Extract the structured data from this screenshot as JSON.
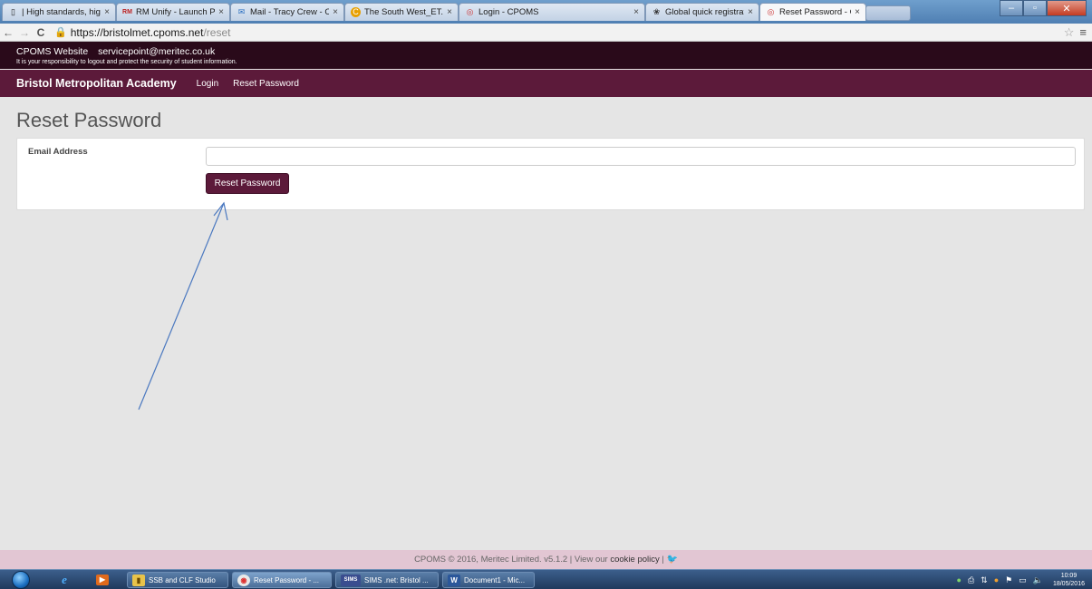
{
  "browser": {
    "tabs": [
      {
        "icon": "page-icon",
        "label": "| High standards, high exp"
      },
      {
        "icon": "rm-icon",
        "label": "RM Unify - Launch Pad"
      },
      {
        "icon": "mail-icon",
        "label": "Mail - Tracy Crew - Outlo"
      },
      {
        "icon": "pdf-icon",
        "label": "The South West_ET.pdf"
      },
      {
        "icon": "cpoms-icon",
        "label": "Login - CPOMS"
      },
      {
        "icon": "registration-icon",
        "label": "Global quick registration"
      },
      {
        "icon": "cpoms-icon",
        "label": "Reset Password - CPOMS"
      }
    ],
    "url_host": "https://bristolmet.cpoms.net",
    "url_path": "/reset"
  },
  "topbar": {
    "website_label": "CPOMS Website",
    "email": "servicepoint@meritec.co.uk",
    "notice": "It is your responsibility to logout and protect the security of student information."
  },
  "navbar": {
    "brand": "Bristol Metropolitan Academy",
    "links": [
      "Login",
      "Reset Password"
    ]
  },
  "page": {
    "title": "Reset Password",
    "email_label": "Email Address",
    "email_value": "",
    "submit_label": "Reset Password"
  },
  "footer": {
    "copyright": "CPOMS © 2016, Meritec Limited. v5.1.2 | View our ",
    "cookie_link": "cookie policy",
    "separator": " | "
  },
  "taskbar": {
    "tasks": [
      {
        "label": "SSB and CLF Studio"
      },
      {
        "label": "Reset Password - ..."
      },
      {
        "label": "SIMS .net: Bristol ..."
      },
      {
        "label": "Document1 - Mic..."
      }
    ],
    "time": "10:09",
    "date": "18/05/2016"
  },
  "colors": {
    "topbar": "#2a0a1a",
    "navbar": "#5c1a3a",
    "footer": "#e2c6d3",
    "button": "#5c1a3a",
    "annotation_arrow": "#4a78c0"
  }
}
